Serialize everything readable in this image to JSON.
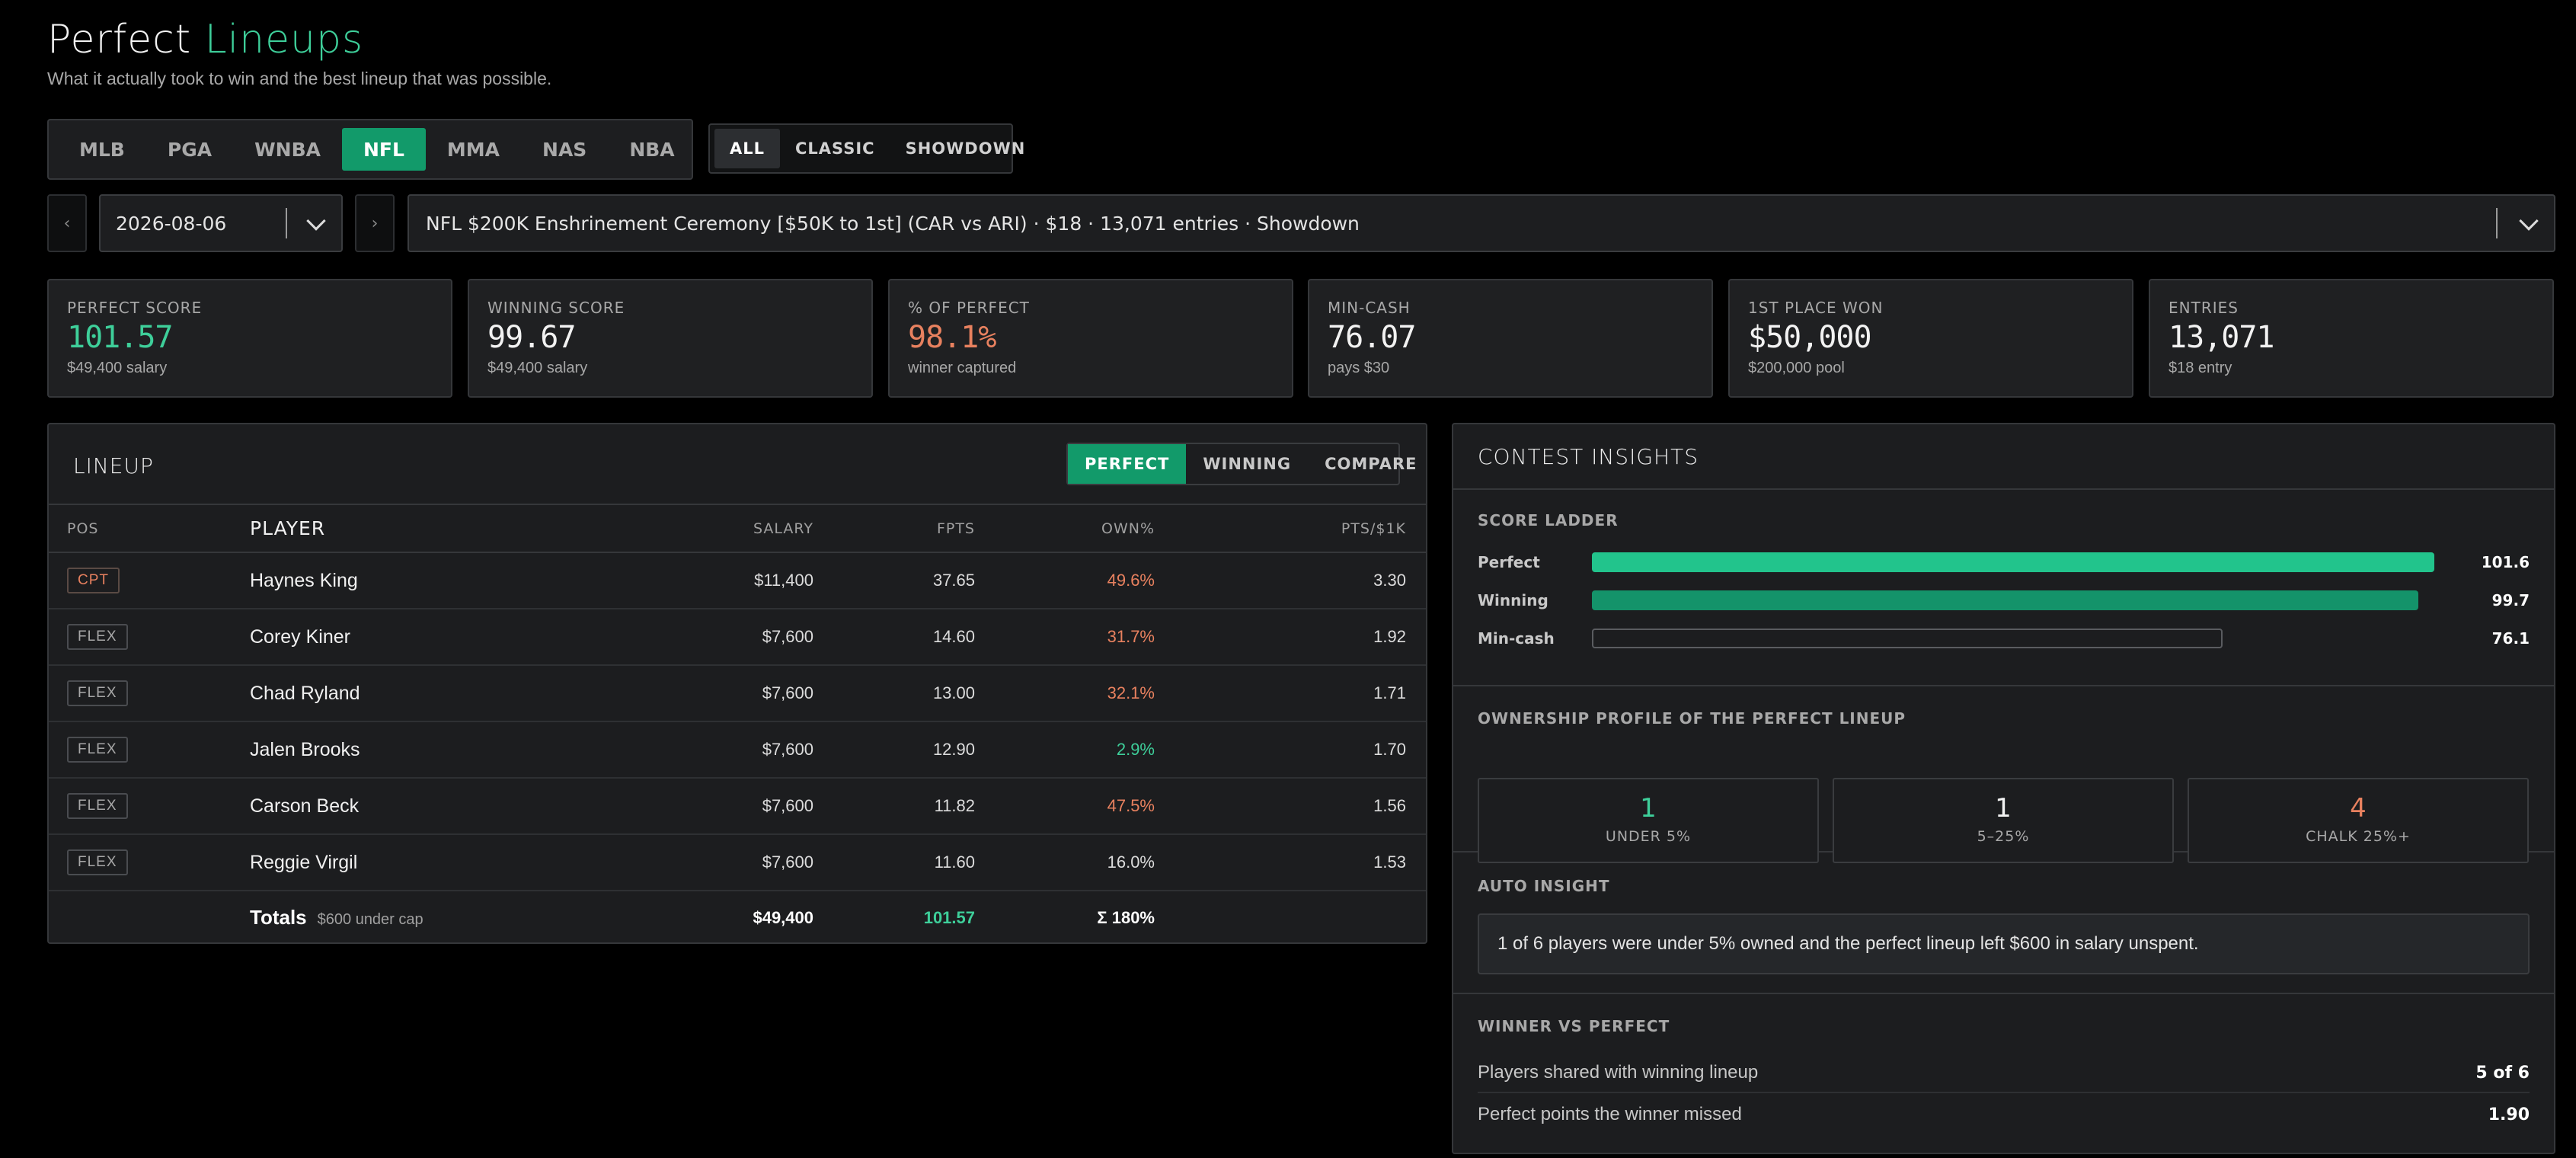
{
  "header": {
    "title_main": "Perfect",
    "title_accent": "Lineups",
    "subtitle": "What it actually took to win and the best lineup that was possible.",
    "accent_color": "#3ecf9a"
  },
  "sport_tabs": [
    "MLB",
    "PGA",
    "WNBA",
    "NFL",
    "MMA",
    "NAS",
    "NBA"
  ],
  "sport_active": "NFL",
  "type_tabs": [
    "ALL",
    "CLASSIC",
    "SHOWDOWN"
  ],
  "type_active": "ALL",
  "nav": {
    "prev_icon": "‹",
    "next_icon": "›"
  },
  "date_select": {
    "value": "2026-08-06"
  },
  "contest_select": {
    "value": "NFL $200K Enshrinement Ceremony [$50K to 1st] (CAR vs ARI) · $18 · 13,071 entries · Showdown"
  },
  "stats": [
    {
      "label": "PERFECT SCORE",
      "value": "101.57",
      "sub": "$49,400 salary",
      "color": "#3ecf9a"
    },
    {
      "label": "WINNING SCORE",
      "value": "99.67",
      "sub": "$49,400 salary",
      "color": "#f2f2f2"
    },
    {
      "label": "% OF PERFECT",
      "value": "98.1%",
      "sub": "winner captured",
      "color": "#e8815f"
    },
    {
      "label": "MIN-CASH",
      "value": "76.07",
      "sub": "pays $30",
      "color": "#f2f2f2"
    },
    {
      "label": "1ST PLACE WON",
      "value": "$50,000",
      "sub": "$200,000 pool",
      "color": "#f2f2f2"
    },
    {
      "label": "ENTRIES",
      "value": "13,071",
      "sub": "$18 entry",
      "color": "#f2f2f2"
    }
  ],
  "lineup": {
    "title": "LINEUP",
    "view_tabs": [
      "PERFECT",
      "WINNING",
      "COMPARE"
    ],
    "view_active": "PERFECT",
    "columns": {
      "pos": "POS",
      "player": "PLAYER",
      "salary": "SALARY",
      "fpts": "FPTS",
      "own": "OWN%",
      "pts": "PTS/$1K"
    },
    "rows": [
      {
        "pos": "CPT",
        "player": "Haynes King",
        "salary": "$11,400",
        "fpts": "37.65",
        "own": "49.6%",
        "own_level": "hi",
        "pts": "3.30"
      },
      {
        "pos": "FLEX",
        "player": "Corey Kiner",
        "salary": "$7,600",
        "fpts": "14.60",
        "own": "31.7%",
        "own_level": "hi",
        "pts": "1.92"
      },
      {
        "pos": "FLEX",
        "player": "Chad Ryland",
        "salary": "$7,600",
        "fpts": "13.00",
        "own": "32.1%",
        "own_level": "hi",
        "pts": "1.71"
      },
      {
        "pos": "FLEX",
        "player": "Jalen Brooks",
        "salary": "$7,600",
        "fpts": "12.90",
        "own": "2.9%",
        "own_level": "lo",
        "pts": "1.70"
      },
      {
        "pos": "FLEX",
        "player": "Carson Beck",
        "salary": "$7,600",
        "fpts": "11.82",
        "own": "47.5%",
        "own_level": "hi",
        "pts": "1.56"
      },
      {
        "pos": "FLEX",
        "player": "Reggie Virgil",
        "salary": "$7,600",
        "fpts": "11.60",
        "own": "16.0%",
        "own_level": "mid",
        "pts": "1.53"
      }
    ],
    "totals": {
      "label": "Totals",
      "sub": "$600 under cap",
      "salary": "$49,400",
      "fpts": "101.57",
      "own": "Σ 180%"
    }
  },
  "insights": {
    "title": "CONTEST INSIGHTS",
    "ladder": {
      "label": "SCORE LADDER",
      "rows": [
        {
          "name": "Perfect",
          "value": "101.6",
          "fraction": 1.0,
          "style": "perfect"
        },
        {
          "name": "Winning",
          "value": "99.7",
          "fraction": 0.981,
          "style": "winning"
        },
        {
          "name": "Min-cash",
          "value": "76.1",
          "fraction": 0.749,
          "style": "mincash"
        }
      ]
    },
    "ownership": {
      "label": "OWNERSHIP PROFILE OF THE PERFECT LINEUP",
      "boxes": [
        {
          "num": "1",
          "cap": "UNDER 5%",
          "color": "#3ecf9a"
        },
        {
          "num": "1",
          "cap": "5–25%",
          "color": "#f2f2f2"
        },
        {
          "num": "4",
          "cap": "CHALK 25%+",
          "color": "#e8815f"
        }
      ]
    },
    "auto": {
      "label": "AUTO INSIGHT",
      "text": "1 of 6 players were under 5% owned and the perfect lineup left $600 in salary unspent."
    },
    "wvp": {
      "label": "WINNER VS PERFECT",
      "rows": [
        {
          "label": "Players shared with winning lineup",
          "value": "5 of 6"
        },
        {
          "label": "Perfect points the winner missed",
          "value": "1.90"
        }
      ]
    }
  }
}
